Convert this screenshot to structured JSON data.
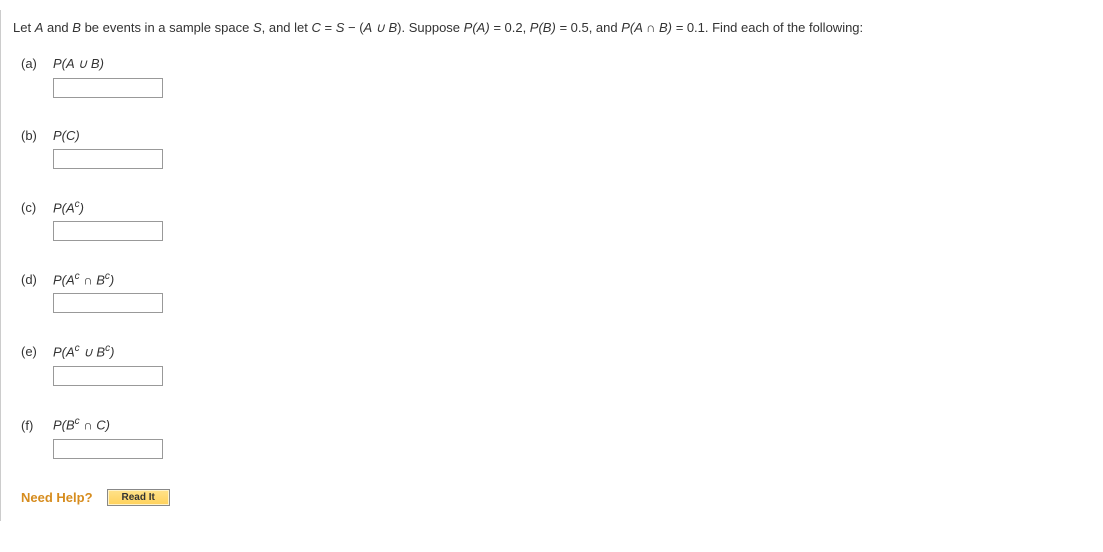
{
  "stem": {
    "pre": "Let ",
    "A": "A",
    "and": " and ",
    "B": "B",
    "t1": " be events in a sample space ",
    "S": "S",
    "t2": ", and let ",
    "C": "C",
    "eq": " = ",
    "S2": "S",
    "minus": " − (",
    "union_expr": "A ∪ B",
    "close": "). Suppose ",
    "PA_lbl": "P",
    "PA_arg": "(A) = ",
    "PA_val": "0.2",
    "sep1": ", ",
    "PB_arg": "P(B) = ",
    "PB_val": "0.5",
    "sep2": ", and ",
    "PAnB_arg": "P(A ∩ B) = ",
    "PAnB_val": "0.1",
    "tail": ". Find each of the following:"
  },
  "parts": {
    "a": {
      "label": "(a)",
      "expr": "P(A ∪ B)"
    },
    "b": {
      "label": "(b)",
      "expr": "P(C)"
    },
    "c": {
      "label": "(c)",
      "expr_html": "P(A^c)"
    },
    "d": {
      "label": "(d)",
      "expr_html": "P(A^c ∩ B^c)"
    },
    "e": {
      "label": "(e)",
      "expr_html": "P(A^c ∪ B^c)"
    },
    "f": {
      "label": "(f)",
      "expr_html": "P(B^c ∩ C)"
    }
  },
  "help": {
    "label": "Need Help?",
    "read_it": "Read It"
  }
}
